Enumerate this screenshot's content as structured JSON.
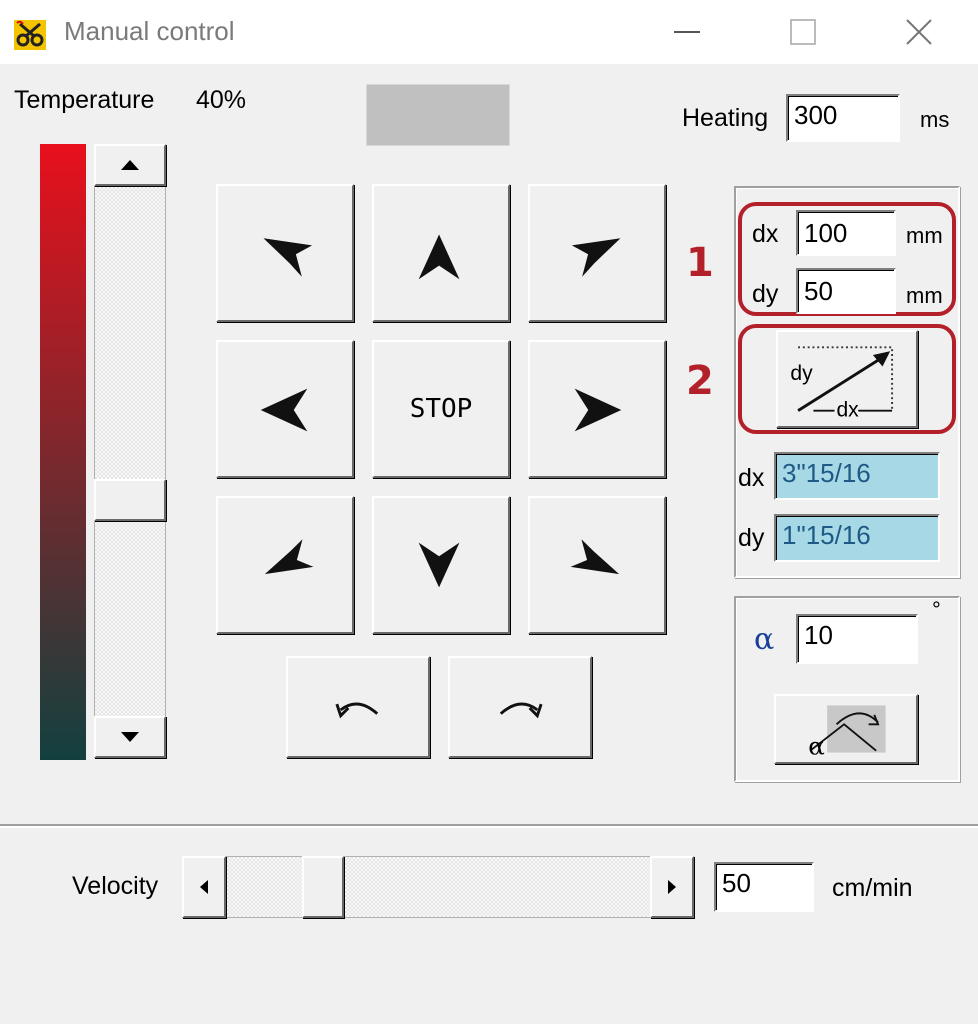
{
  "window": {
    "title": "Manual control",
    "minimize_glyph": "—",
    "maximize_glyph": "☐",
    "close_glyph": "✕",
    "app_icon": "scissors-icon"
  },
  "temperature": {
    "label": "Temperature",
    "value": "40%",
    "level_fraction": 0.4,
    "gradient_top": "#e8101c",
    "gradient_bottom": "#12403e"
  },
  "heating": {
    "label": "Heating",
    "value": "300",
    "unit": "ms"
  },
  "move": {
    "stop_label": "STOP",
    "buttons": [
      "up-left",
      "up",
      "up-right",
      "left",
      "stop",
      "right",
      "down-left",
      "down",
      "down-right"
    ],
    "rotate": [
      "rotate-ccw",
      "rotate-cw"
    ]
  },
  "offset": {
    "dx_label": "dx",
    "dx_value": "100",
    "dx_unit": "mm",
    "dy_label": "dy",
    "dy_value": "50",
    "dy_unit": "mm",
    "diagram_dy": "dy",
    "diagram_dx": "dx",
    "res_dx_label": "dx",
    "res_dx_value": "3\"15/16",
    "res_dy_label": "dy",
    "res_dy_value": "1\"15/16"
  },
  "callouts": {
    "one": "1",
    "two": "2",
    "color": "#b4202a"
  },
  "rotation": {
    "symbol": "α",
    "value": "10",
    "unit": "°",
    "button_symbol": "α"
  },
  "velocity": {
    "label": "Velocity",
    "value": "50",
    "unit": "cm/min",
    "slider_fraction": 0.2
  }
}
